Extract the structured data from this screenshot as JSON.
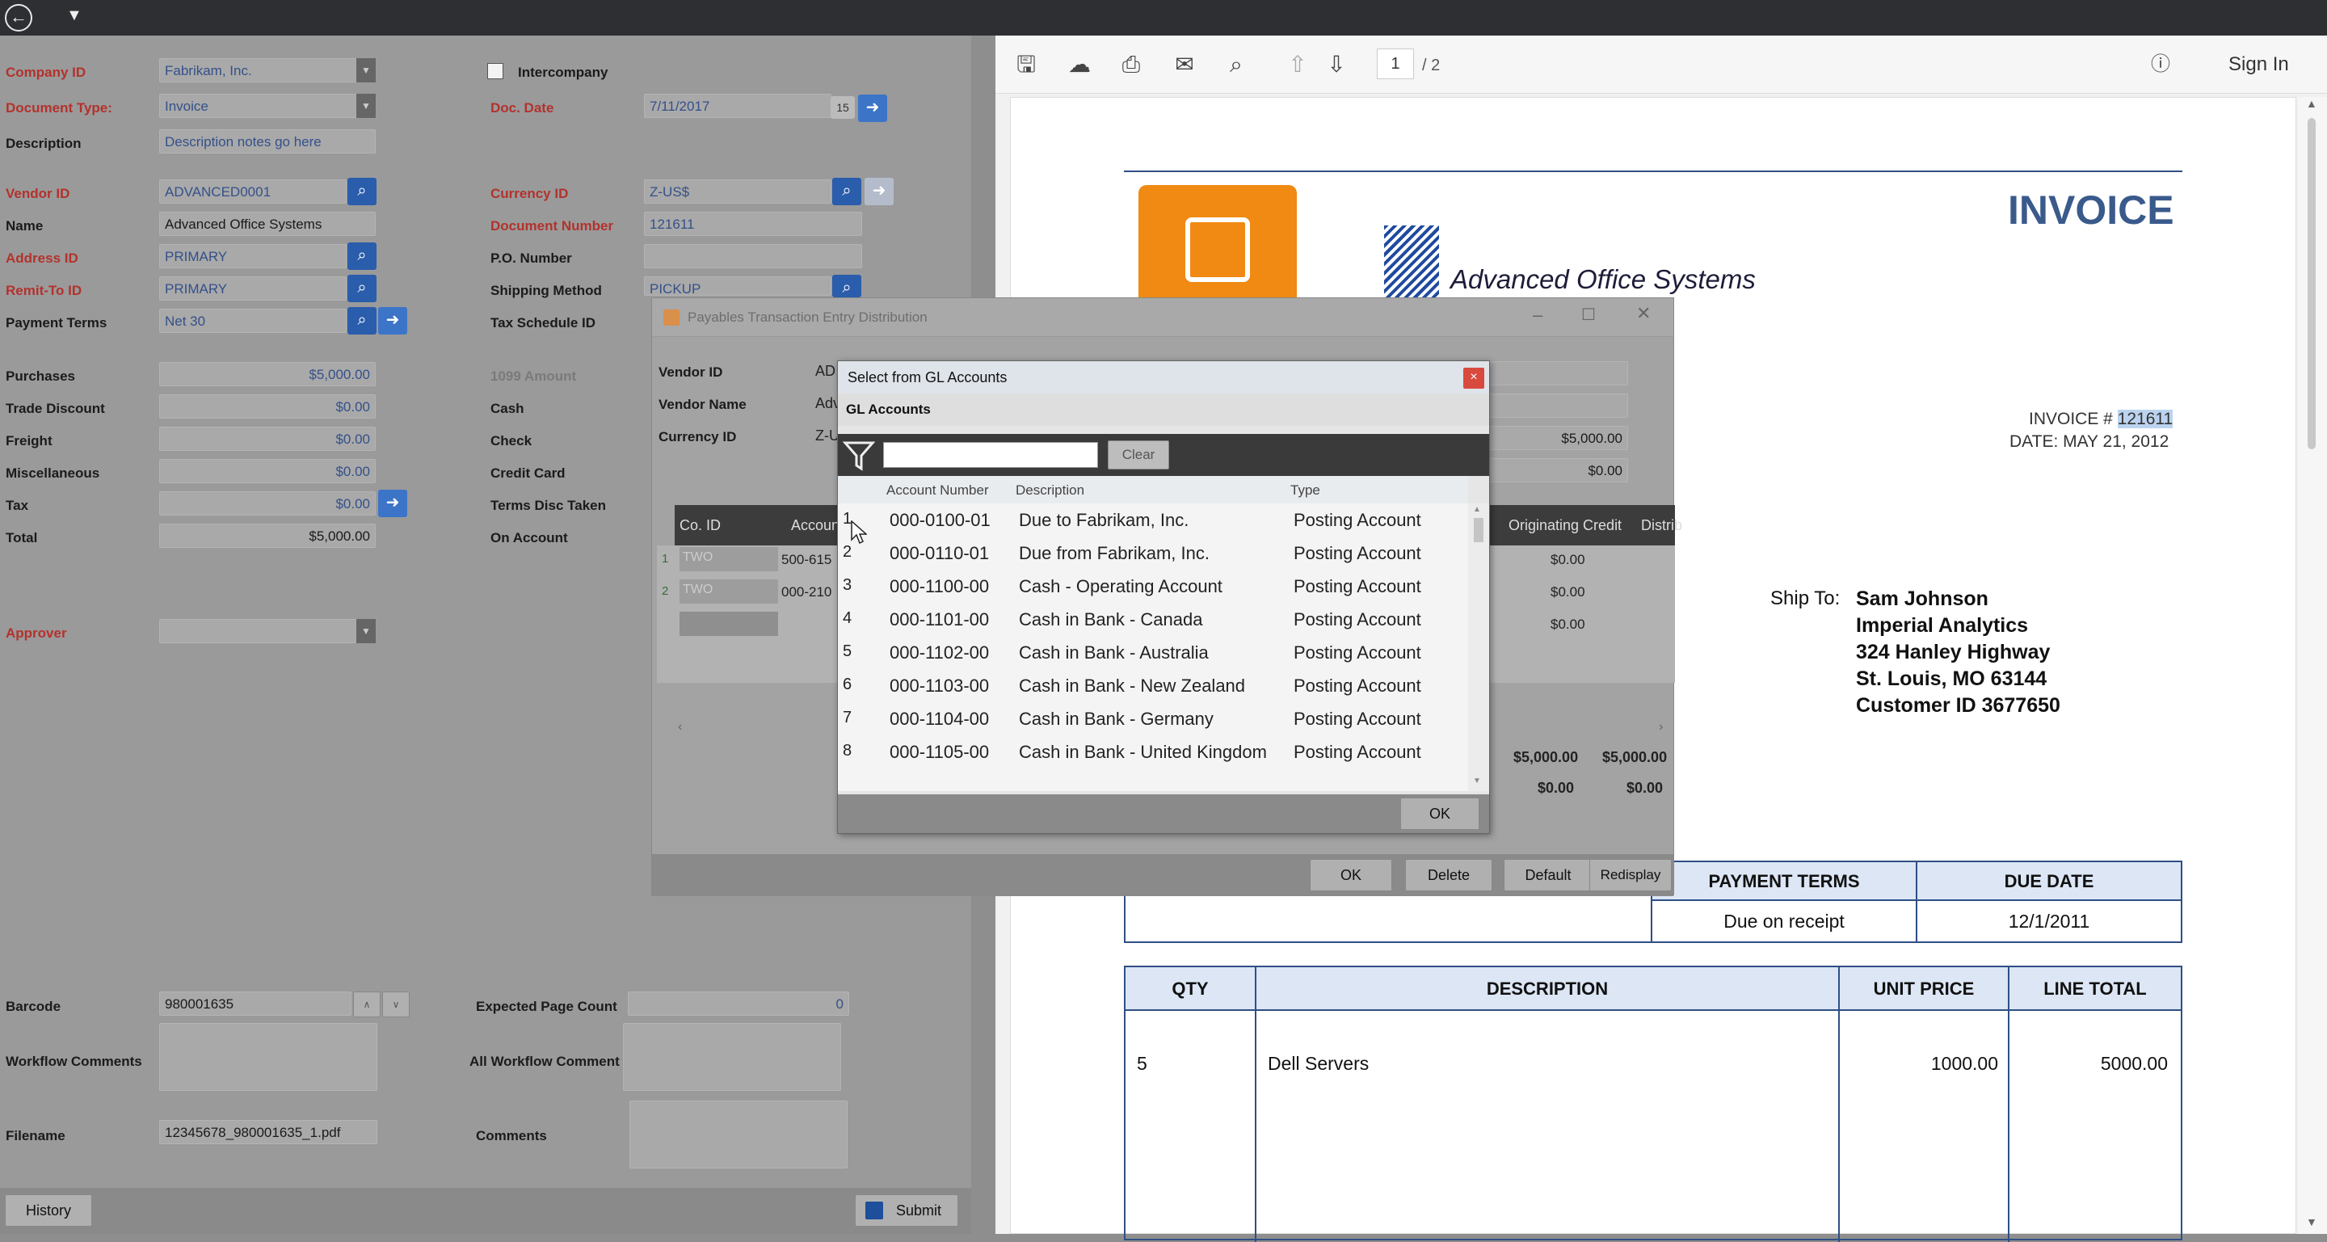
{
  "left_form": {
    "company_id_label": "Company ID",
    "company_id_value": "Fabrikam, Inc.",
    "intercompany_label": "Intercompany",
    "document_type_label": "Document Type:",
    "document_type_value": "Invoice",
    "doc_date_label": "Doc. Date",
    "doc_date_value": "7/11/2017",
    "description_label": "Description",
    "description_value": "Description notes go here",
    "vendor_id_label": "Vendor ID",
    "vendor_id_value": "ADVANCED0001",
    "currency_id_label": "Currency ID",
    "currency_id_value": "Z-US$",
    "name_label": "Name",
    "name_value": "Advanced Office Systems",
    "document_number_label": "Document Number",
    "document_number_value": "121611",
    "address_id_label": "Address ID",
    "address_id_value": "PRIMARY",
    "po_number_label": "P.O. Number",
    "remit_to_id_label": "Remit-To ID",
    "remit_to_id_value": "PRIMARY",
    "shipping_method_label": "Shipping Method",
    "shipping_method_value": "PICKUP",
    "payment_terms_label": "Payment Terms",
    "payment_terms_value": "Net 30",
    "tax_schedule_id_label": "Tax Schedule ID",
    "purchases_label": "Purchases",
    "purchases_value": "$5,000.00",
    "amount_1099_label": "1099 Amount",
    "trade_discount_label": "Trade Discount",
    "trade_discount_value": "$0.00",
    "cash_label": "Cash",
    "freight_label": "Freight",
    "freight_value": "$0.00",
    "check_label": "Check",
    "miscellaneous_label": "Miscellaneous",
    "miscellaneous_value": "$0.00",
    "credit_card_label": "Credit Card",
    "tax_label": "Tax",
    "tax_value": "$0.00",
    "terms_disc_taken_label": "Terms Disc Taken",
    "total_label": "Total",
    "total_value": "$5,000.00",
    "on_account_label": "On Account",
    "approver_label": "Approver",
    "barcode_label": "Barcode",
    "barcode_value": "980001635",
    "expected_page_count_label": "Expected Page Count",
    "expected_page_count_value": "0",
    "workflow_comments_label": "Workflow Comments",
    "all_workflow_comment_label": "All Workflow Comment",
    "filename_label": "Filename",
    "filename_value": "12345678_980001635_1.pdf",
    "comments_label": "Comments",
    "history_button": "History",
    "submit_button": "Submit"
  },
  "distribution_dialog": {
    "title": "Payables Transaction Entry Distribution",
    "vendor_id_label": "Vendor ID",
    "vendor_id_value": "AD",
    "vendor_name_label": "Vendor Name",
    "vendor_name_value": "Adv",
    "currency_id_label": "Currency ID",
    "currency_id_value": "Z-U",
    "right_values": [
      "$5,000.00",
      "$0.00"
    ],
    "grid_headers": [
      "Co. ID",
      "Account",
      "Originating Credit",
      "Distrib"
    ],
    "grid_rows": [
      {
        "num": "1",
        "co": "TWO",
        "account": "500-615",
        "credit": "$0.00"
      },
      {
        "num": "2",
        "co": "TWO",
        "account": "000-210",
        "credit": "$0.00"
      },
      {
        "num": "",
        "co": "",
        "account": "",
        "credit": "$0.00"
      }
    ],
    "totals_row1": [
      "$5,000.00",
      "$5,000.00"
    ],
    "totals_row2": [
      "$0.00",
      "$0.00"
    ],
    "ok_button": "OK",
    "delete_button": "Delete",
    "default_button": "Default",
    "redisplay_button": "Redisplay"
  },
  "gl_dialog": {
    "title": "Select from GL Accounts",
    "section_title": "GL Accounts",
    "clear_button": "Clear",
    "columns": [
      "Account Number",
      "Description",
      "Type"
    ],
    "rows": [
      {
        "num": "1",
        "account": "000-0100-01",
        "description": "Due to Fabrikam, Inc.",
        "type": "Posting Account"
      },
      {
        "num": "2",
        "account": "000-0110-01",
        "description": "Due from Fabrikam, Inc.",
        "type": "Posting Account"
      },
      {
        "num": "3",
        "account": "000-1100-00",
        "description": "Cash - Operating Account",
        "type": "Posting Account"
      },
      {
        "num": "4",
        "account": "000-1101-00",
        "description": "Cash in Bank - Canada",
        "type": "Posting Account"
      },
      {
        "num": "5",
        "account": "000-1102-00",
        "description": "Cash in Bank - Australia",
        "type": "Posting Account"
      },
      {
        "num": "6",
        "account": "000-1103-00",
        "description": "Cash in Bank - New Zealand",
        "type": "Posting Account"
      },
      {
        "num": "7",
        "account": "000-1104-00",
        "description": "Cash in Bank - Germany",
        "type": "Posting Account"
      },
      {
        "num": "8",
        "account": "000-1105-00",
        "description": "Cash in Bank - United Kingdom",
        "type": "Posting Account"
      }
    ],
    "ok_button": "OK"
  },
  "viewer": {
    "page_current": "1",
    "page_total": "/ 2",
    "sign_in": "Sign In"
  },
  "invoice": {
    "title": "INVOICE",
    "company_name": "Advanced Office Systems",
    "invoice_number_label": "INVOICE #",
    "invoice_number": "121611",
    "date_line": "DATE: MAY 21, 2012",
    "ship_to_label": "Ship To:",
    "ship_to_lines": [
      "Sam Johnson",
      "Imperial Analytics",
      "324 Hanley Highway",
      "St. Louis, MO 63144",
      "Customer ID 3677650"
    ],
    "terms_headers": [
      "PAYMENT TERMS",
      "DUE DATE"
    ],
    "terms_values": [
      "Due on receipt",
      "12/1/2011"
    ],
    "line_headers": [
      "QTY",
      "DESCRIPTION",
      "UNIT PRICE",
      "LINE TOTAL"
    ],
    "line_items": [
      {
        "qty": "5",
        "description": "Dell Servers",
        "unit_price": "1000.00",
        "line_total": "5000.00"
      }
    ]
  }
}
